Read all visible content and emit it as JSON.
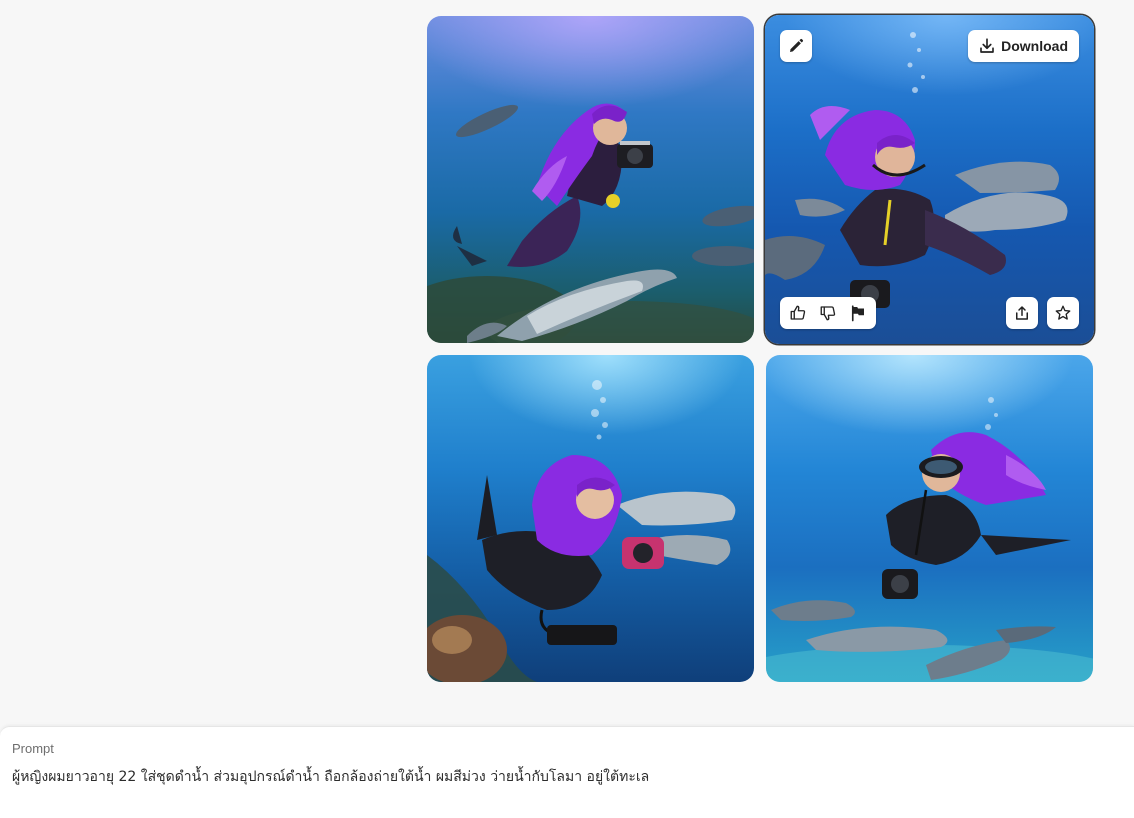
{
  "gallery": {
    "images": [
      {
        "alt_icon": "image-1"
      },
      {
        "alt_icon": "image-2"
      },
      {
        "alt_icon": "image-3"
      },
      {
        "alt_icon": "image-4"
      }
    ],
    "toolbar": {
      "edit_icon": "pencil-icon",
      "download_label": "Download",
      "download_icon": "download-icon",
      "like_icon": "thumbs-up-icon",
      "dislike_icon": "thumbs-down-icon",
      "report_icon": "flag-icon",
      "share_icon": "share-icon",
      "favorite_icon": "star-icon"
    }
  },
  "prompt": {
    "label": "Prompt",
    "text": "ผู้หญิงผมยาวอายุ 22 ใส่ชุดดำน้ำ ส่วมอุปกรณ์ดำน้ำ ถือกล้องถ่ายใต้น้ำ ผมสีม่วง ว่ายน้ำกับโลมา อยู่ใต้ทะเล"
  },
  "colors": {
    "page_background": "#f7f7f7",
    "panel_background": "#ffffff",
    "hair_purple": "#8a2be2",
    "water_blue": "#1c6fc8"
  }
}
